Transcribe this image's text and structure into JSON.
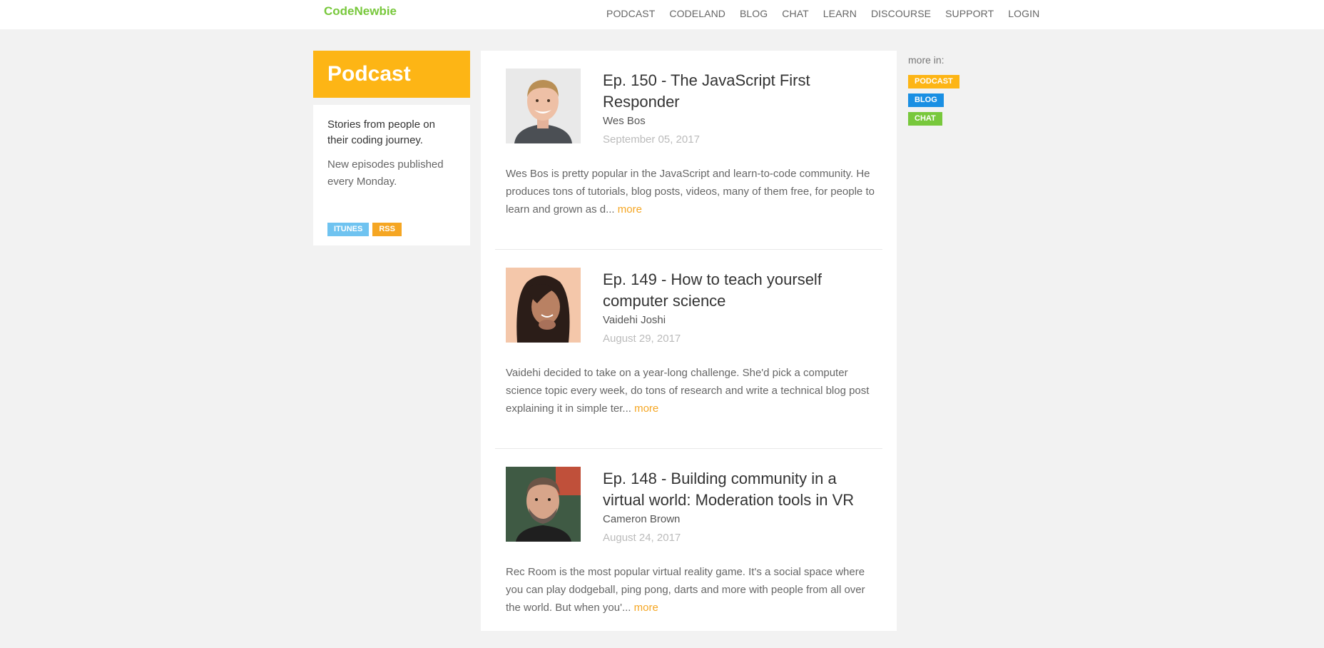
{
  "header": {
    "logo": "CodeNewbie",
    "nav": [
      "PODCAST",
      "CODELAND",
      "BLOG",
      "CHAT",
      "LEARN",
      "DISCOURSE",
      "SUPPORT",
      "LOGIN"
    ]
  },
  "sidebar": {
    "title": "Podcast",
    "tagline": "Stories from people on their coding journey.",
    "schedule": "New episodes published every Monday.",
    "badges": [
      "ITUNES",
      "RSS"
    ]
  },
  "episodes": [
    {
      "title": "Ep. 150 - The JavaScript First Responder",
      "guest": "Wes Bos",
      "date": "September 05, 2017",
      "description": "Wes Bos is pretty popular in the JavaScript and learn-to-code community. He produces tons of tutorials, blog posts, videos, many of them free, for people to learn and grown as d...",
      "more": "more"
    },
    {
      "title": "Ep. 149 - How to teach yourself computer science",
      "guest": "Vaidehi Joshi",
      "date": "August 29, 2017",
      "description": "Vaidehi decided to take on a year-long challenge. She'd pick a computer science topic every week, do tons of research and write a technical blog post explaining it in simple ter...",
      "more": "more"
    },
    {
      "title": "Ep. 148 - Building community in a virtual world: Moderation tools in VR",
      "guest": "Cameron Brown",
      "date": "August 24, 2017",
      "description": "Rec Room is the most popular virtual reality game. It's a social space where you can play dodgeball, ping pong, darts and more with people from all over the world. But when you'...",
      "more": "more"
    }
  ],
  "right": {
    "label": "more in:",
    "badges": [
      "PODCAST",
      "BLOG",
      "CHAT"
    ]
  },
  "colors": {
    "brand_green": "#78c83c",
    "podcast_yellow": "#fdb515",
    "blog_blue": "#1a8fe3",
    "itunes_blue": "#6fc3f0",
    "link_orange": "#f5a623"
  }
}
